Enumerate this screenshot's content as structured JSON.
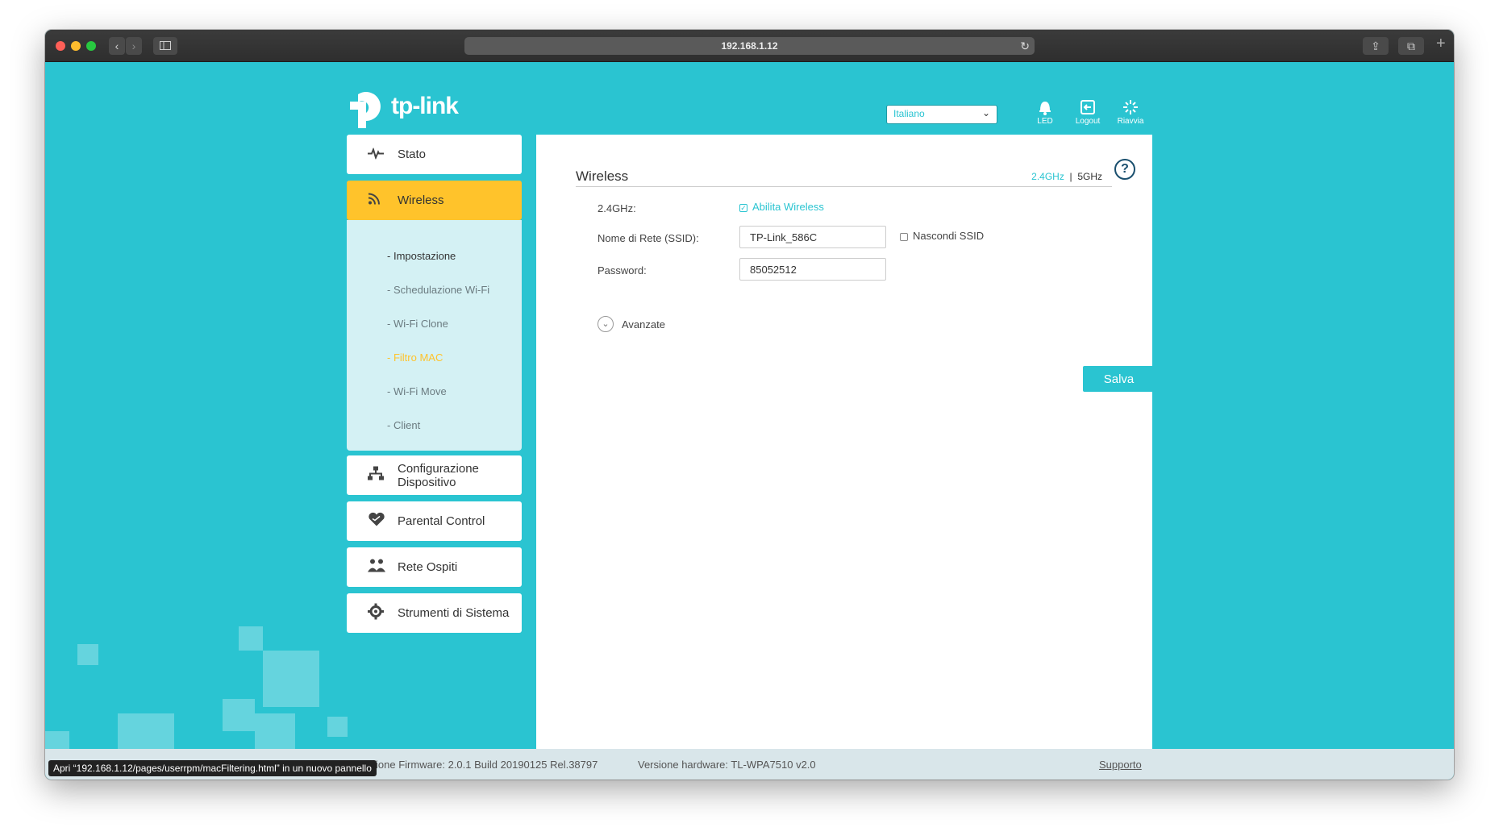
{
  "browser": {
    "url": "192.168.1.12",
    "status_bar": "Apri “192.168.1.12/pages/userrpm/macFiltering.html” in un nuovo pannello"
  },
  "header": {
    "logo_text": "tp-link",
    "language": "Italiano",
    "icons": [
      {
        "name": "led",
        "icon": "bell-icon",
        "label": "LED"
      },
      {
        "name": "logout",
        "icon": "logout-icon",
        "label": "Logout"
      },
      {
        "name": "riavvia",
        "icon": "restart-icon",
        "label": "Riavvia"
      }
    ]
  },
  "sidebar": {
    "items": [
      {
        "label": "Stato",
        "icon": "pulse-icon"
      },
      {
        "label": "Wireless",
        "icon": "wireless-icon",
        "active": true
      },
      {
        "label": "Configurazione Dispositivo",
        "icon": "network-icon"
      },
      {
        "label": "Parental Control",
        "icon": "heart-icon"
      },
      {
        "label": "Rete Ospiti",
        "icon": "guests-icon"
      },
      {
        "label": "Strumenti di Sistema",
        "icon": "gear-icon"
      }
    ],
    "submenu": [
      {
        "label": "Impostazione",
        "state": "current"
      },
      {
        "label": "Schedulazione Wi-Fi"
      },
      {
        "label": "Wi-Fi Clone"
      },
      {
        "label": "Filtro MAC",
        "state": "hover"
      },
      {
        "label": "Wi-Fi Move"
      },
      {
        "label": "Client"
      }
    ]
  },
  "main": {
    "title": "Wireless",
    "band_24": "2.4GHz",
    "band_sep": "|",
    "band_5": "5GHz",
    "band_label": "2.4GHz:",
    "enable_label": "Abilita Wireless",
    "enable_checked": true,
    "ssid_label": "Nome di Rete (SSID):",
    "ssid_value": "TP-Link_586C",
    "hide_ssid_label": "Nascondi SSID",
    "hide_ssid_checked": false,
    "password_label": "Password:",
    "password_value": "85052512",
    "advanced_label": "Avanzate",
    "save_label": "Salva"
  },
  "footer": {
    "firmware": "Versione Firmware: 2.0.1 Build 20190125 Rel.38797",
    "hardware": "Versione hardware: TL-WPA7510 v2.0",
    "support": "Supporto"
  },
  "colors": {
    "accent": "#2ac4d1",
    "active": "#ffc32b"
  }
}
